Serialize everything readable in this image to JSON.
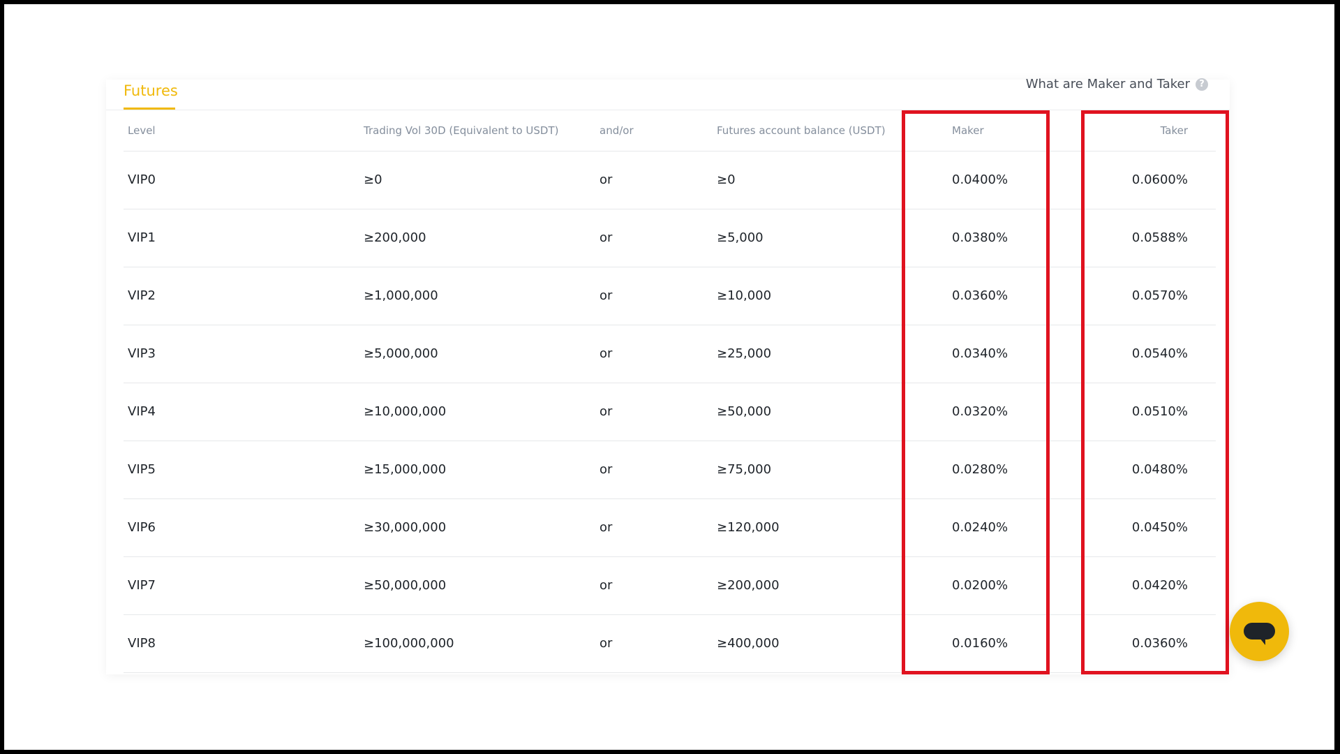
{
  "tabs": [
    {
      "label": "Futures",
      "active": true
    }
  ],
  "help_link": {
    "label": "What are Maker and Taker",
    "icon": "question-circle-icon"
  },
  "table": {
    "headers": {
      "level": "Level",
      "volume": "Trading Vol 30D (Equivalent to USDT)",
      "andor": "and/or",
      "balance": "Futures account balance (USDT)",
      "maker": "Maker",
      "taker": "Taker"
    },
    "rows": [
      {
        "level": "VIP0",
        "volume": "≥0",
        "andor": "or",
        "balance": "≥0",
        "maker": "0.0400%",
        "taker": "0.0600%"
      },
      {
        "level": "VIP1",
        "volume": "≥200,000",
        "andor": "or",
        "balance": "≥5,000",
        "maker": "0.0380%",
        "taker": "0.0588%"
      },
      {
        "level": "VIP2",
        "volume": "≥1,000,000",
        "andor": "or",
        "balance": "≥10,000",
        "maker": "0.0360%",
        "taker": "0.0570%"
      },
      {
        "level": "VIP3",
        "volume": "≥5,000,000",
        "andor": "or",
        "balance": "≥25,000",
        "maker": "0.0340%",
        "taker": "0.0540%"
      },
      {
        "level": "VIP4",
        "volume": "≥10,000,000",
        "andor": "or",
        "balance": "≥50,000",
        "maker": "0.0320%",
        "taker": "0.0510%"
      },
      {
        "level": "VIP5",
        "volume": "≥15,000,000",
        "andor": "or",
        "balance": "≥75,000",
        "maker": "0.0280%",
        "taker": "0.0480%"
      },
      {
        "level": "VIP6",
        "volume": "≥30,000,000",
        "andor": "or",
        "balance": "≥120,000",
        "maker": "0.0240%",
        "taker": "0.0450%"
      },
      {
        "level": "VIP7",
        "volume": "≥50,000,000",
        "andor": "or",
        "balance": "≥200,000",
        "maker": "0.0200%",
        "taker": "0.0420%"
      },
      {
        "level": "VIP8",
        "volume": "≥100,000,000",
        "andor": "or",
        "balance": "≥400,000",
        "maker": "0.0160%",
        "taker": "0.0360%"
      }
    ]
  },
  "annotations": {
    "highlight_color": "#e0121f"
  },
  "chat": {
    "icon": "chat-bubble-icon",
    "color": "#f0b90b"
  }
}
